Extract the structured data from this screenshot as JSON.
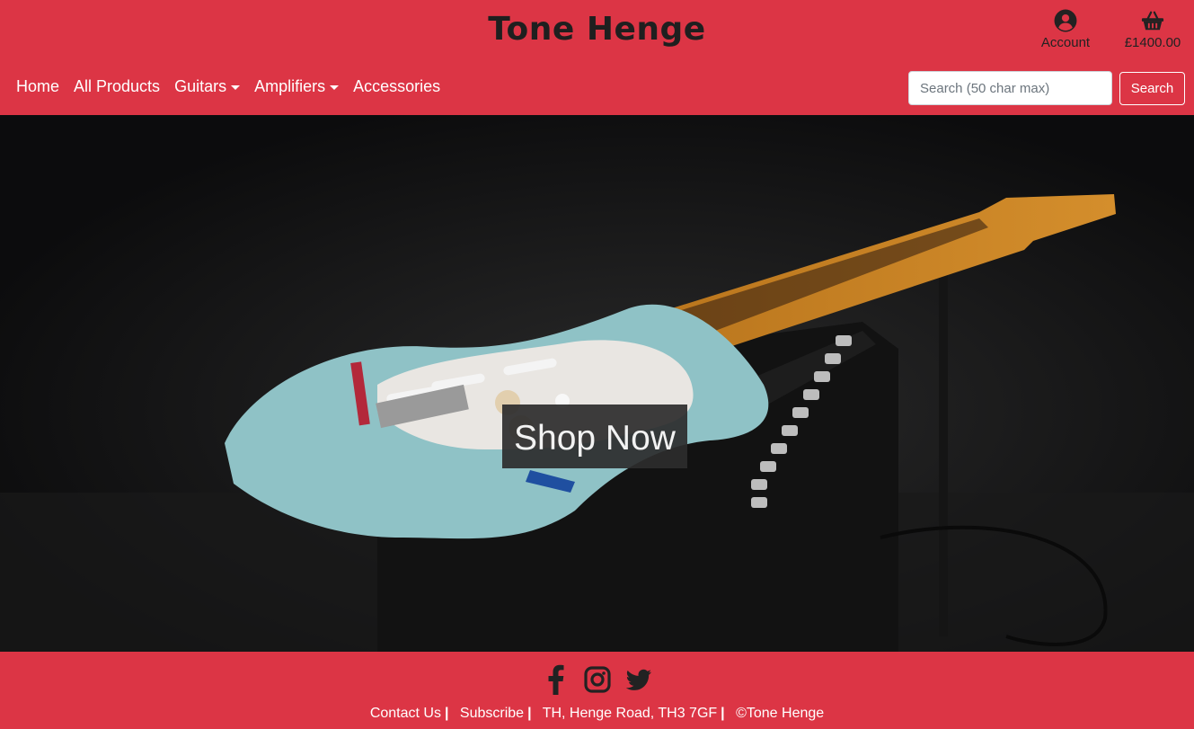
{
  "brand": {
    "title": "Tone Henge"
  },
  "header": {
    "account_label": "Account",
    "basket_total": "£1400.00"
  },
  "nav": {
    "items": [
      {
        "label": "Home"
      },
      {
        "label": "All Products"
      },
      {
        "label": "Guitars"
      },
      {
        "label": "Amplifiers"
      },
      {
        "label": "Accessories"
      }
    ]
  },
  "search": {
    "placeholder": "Search (50 char max)",
    "button_label": "Search"
  },
  "hero": {
    "cta_label": "Shop Now"
  },
  "footer": {
    "social_icons": [
      "facebook-icon",
      "instagram-icon",
      "twitter-icon"
    ],
    "links": {
      "contact": "Contact Us",
      "subscribe": "Subscribe",
      "address": "TH, Henge Road, TH3 7GF",
      "copyright": "©Tone Henge"
    },
    "separator": "|"
  },
  "colors": {
    "brand_red": "#dc3545",
    "dark_text": "#222222",
    "hero_bg": "#0f1011"
  }
}
